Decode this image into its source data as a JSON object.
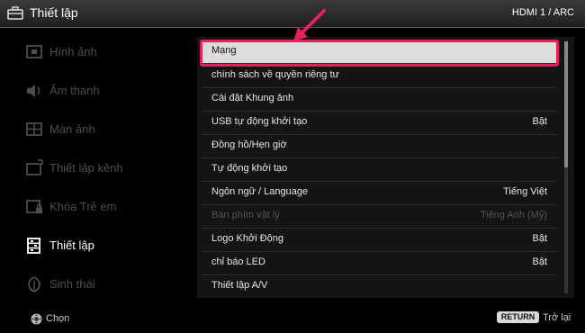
{
  "header": {
    "title": "Thiết lập",
    "input_source": "HDMI 1 / ARC",
    "icon": "toolbox-icon"
  },
  "sidebar": {
    "items": [
      {
        "label": "Hình ảnh",
        "icon": "picture-icon",
        "active": false
      },
      {
        "label": "Âm thanh",
        "icon": "speaker-icon",
        "active": false
      },
      {
        "label": "Màn ảnh",
        "icon": "screen-icon",
        "active": false
      },
      {
        "label": "Thiết lập kênh",
        "icon": "channel-setup-icon",
        "active": false
      },
      {
        "label": "Khóa Trẻ em",
        "icon": "parental-lock-icon",
        "active": false
      },
      {
        "label": "Thiết lập",
        "icon": "settings-icon",
        "active": true
      },
      {
        "label": "Sinh thái",
        "icon": "eco-leaf-icon",
        "active": false
      }
    ]
  },
  "menu": {
    "items": [
      {
        "label": "Mạng",
        "value": "",
        "state": "selected"
      },
      {
        "label": "chính sách về quyền riêng tư",
        "value": "",
        "state": "normal"
      },
      {
        "label": "Cài đặt Khung ảnh",
        "value": "",
        "state": "normal"
      },
      {
        "label": "USB tự động khởi tạo",
        "value": "Bật",
        "state": "normal"
      },
      {
        "label": "Đồng hồ/Hẹn giờ",
        "value": "",
        "state": "normal"
      },
      {
        "label": "Tự động khởi tạo",
        "value": "",
        "state": "normal"
      },
      {
        "label": "Ngôn ngữ / Language",
        "value": "Tiếng Việt",
        "state": "normal"
      },
      {
        "label": "Bàn phím vật lý",
        "value": "Tiếng Anh (Mỹ)",
        "state": "disabled"
      },
      {
        "label": "Logo Khởi Động",
        "value": "Bật",
        "state": "normal"
      },
      {
        "label": "chỉ báo LED",
        "value": "Bật",
        "state": "normal"
      },
      {
        "label": "Thiết lập A/V",
        "value": "",
        "state": "normal"
      }
    ],
    "scroll_position": 0.0
  },
  "footer": {
    "select_label": "Chọn",
    "return_key": "RETURN",
    "return_label": "Trở lại"
  },
  "colors": {
    "highlight": "#e5215a",
    "background": "#000000",
    "selected_row": "#dcdcdc"
  }
}
